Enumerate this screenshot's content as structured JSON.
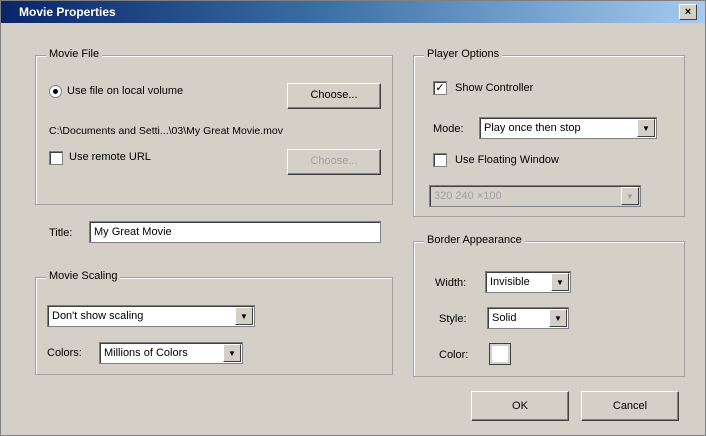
{
  "window": {
    "title": "Movie Properties",
    "close_glyph": "×"
  },
  "movie_file": {
    "group_label": "Movie File",
    "local_radio_label": "Use file on local volume",
    "choose_label": "Choose...",
    "path_text": "C:\\Documents and Setti...\\03\\My Great Movie.mov",
    "remote_label": "Use remote URL",
    "remote_button_label": "Choose..."
  },
  "title_field": {
    "label": "Title:",
    "value": "My Great Movie"
  },
  "movie_scaling": {
    "group_label": "Movie Scaling",
    "scaling_value": "Don't show scaling",
    "colors_label": "Colors:",
    "colors_value": "Millions of Colors"
  },
  "player_options": {
    "group_label": "Player Options",
    "show_controller_label": "Show Controller",
    "show_controller_checked": true,
    "mode_label": "Mode:",
    "mode_value": "Play once then stop",
    "floating_label": "Use Floating Window",
    "floating_checked": false,
    "size_value": "320 240 ×100"
  },
  "border": {
    "group_label": "Border Appearance",
    "width_label": "Width:",
    "width_value": "Invisible",
    "style_label": "Style:",
    "style_value": "Solid",
    "color_label": "Color:",
    "color_hex": "#ffffff"
  },
  "footer": {
    "ok_label": "OK",
    "cancel_label": "Cancel"
  }
}
